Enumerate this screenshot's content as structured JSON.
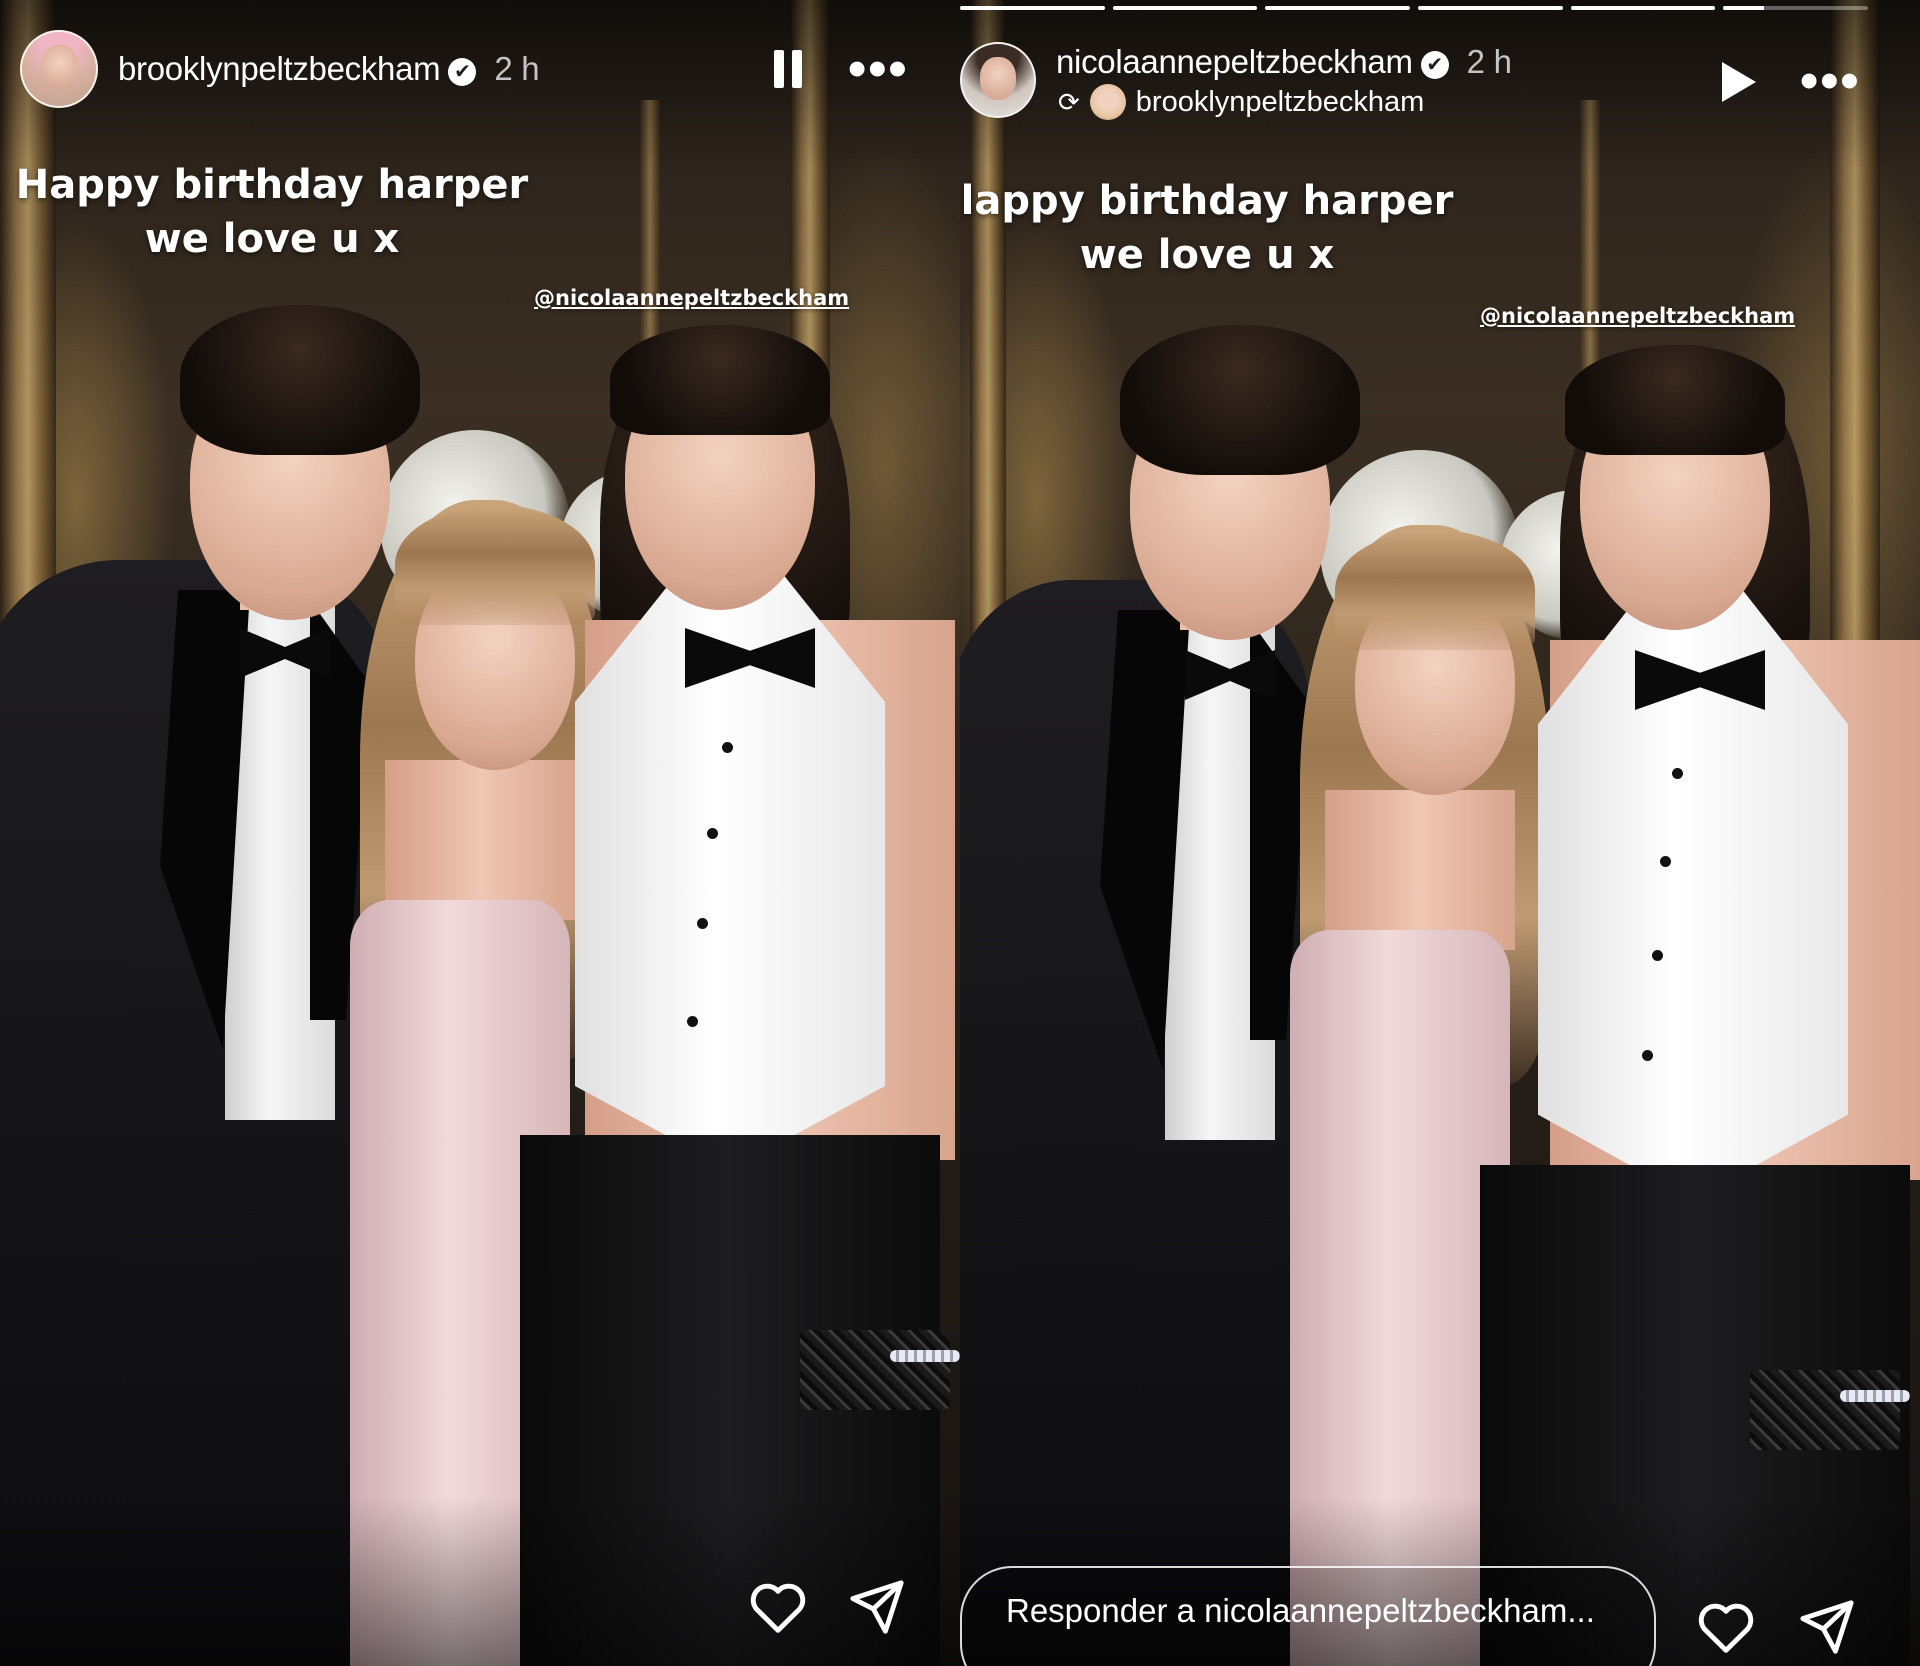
{
  "left_story": {
    "username": "brooklynpeltzbeckham",
    "time": "2 h",
    "verified_icon": "verified-badge-icon",
    "playback_state": "paused",
    "caption_line1": "Happy birthday harper",
    "caption_line2": "we love u x",
    "mention": "@nicolaannepeltzbeckham"
  },
  "right_story": {
    "username": "nicolaannepeltzbeckham",
    "time": "2 h",
    "verified_icon": "verified-badge-icon",
    "repost_from": "brooklynpeltzbeckham",
    "playback_state": "playing",
    "caption_line1": "lappy birthday harper",
    "caption_line2": "we love u x",
    "mention": "@nicolaannepeltzbeckham",
    "reply_placeholder": "Responder a nicolaannepeltzbeckham...",
    "progress": [
      1,
      1,
      1,
      1,
      1,
      0.28
    ]
  },
  "icons": {
    "verified": "✔",
    "more": "•••",
    "repost": "⟳"
  },
  "colors": {
    "overlay_text": "#ffffff",
    "background": "#241d17"
  }
}
